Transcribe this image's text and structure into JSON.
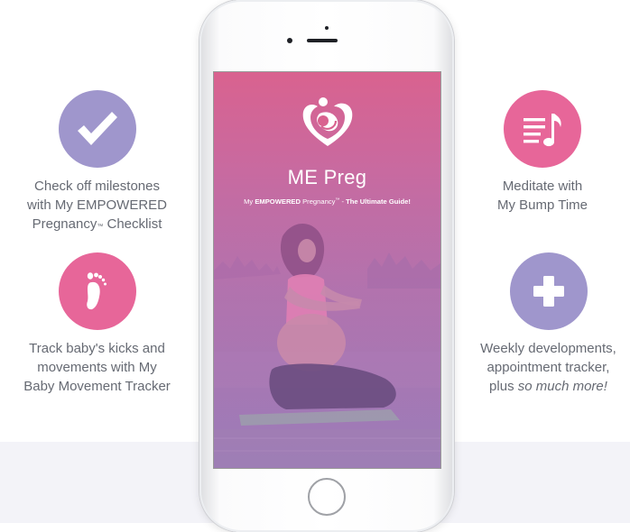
{
  "app": {
    "title": "ME Preg",
    "tagline_prefix": "My ",
    "tagline_bold1": "EMPOWERED",
    "tagline_middle": " Pregnancy",
    "tagline_tm": "™",
    "tagline_dash": " - ",
    "tagline_bold2": "The Ultimate Guide!"
  },
  "features": {
    "checklist": {
      "icon": "checkmark-icon",
      "color": "#9f96cc",
      "line1": "Check off milestones",
      "line2": "with My EMPOWERED",
      "line3a": "Pregnancy",
      "line3tm": "™",
      "line3b": " Checklist"
    },
    "kicks": {
      "icon": "footprint-icon",
      "color": "#e76699",
      "line1": "Track baby's kicks and",
      "line2": "movements with My",
      "line3": "Baby Movement Tracker"
    },
    "meditate": {
      "icon": "music-list-icon",
      "color": "#e76699",
      "line1": "Meditate with",
      "line2": "My Bump Time"
    },
    "weekly": {
      "icon": "plus-icon",
      "color": "#9f96cc",
      "line1": "Weekly developments,",
      "line2": "appointment tracker,",
      "line3a": "plus ",
      "line3b": "so much more!"
    }
  },
  "colors": {
    "pink": "#e76699",
    "lavender": "#9f96cc",
    "text": "#666a73",
    "band": "#f3f3f8"
  }
}
